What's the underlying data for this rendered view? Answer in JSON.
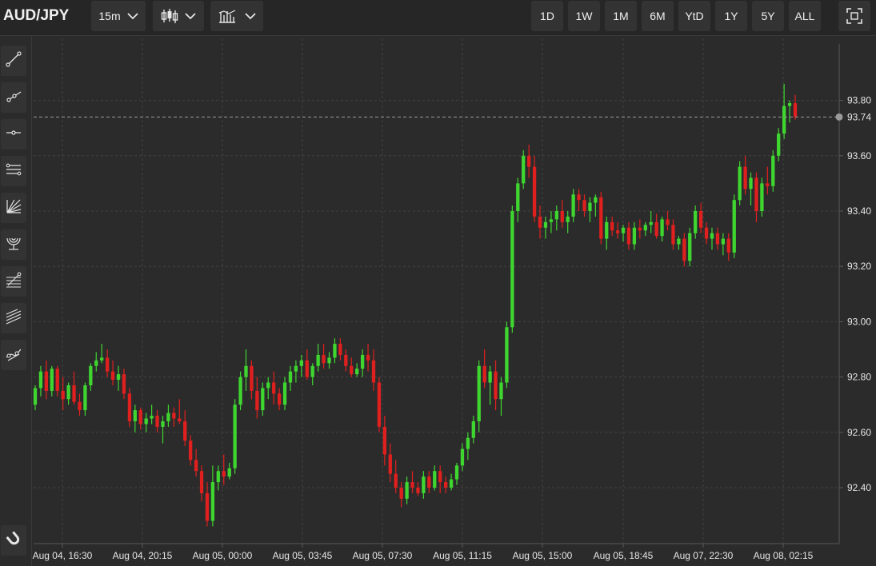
{
  "header": {
    "symbol": "AUD/JPY",
    "interval": "15m",
    "ranges": [
      "1D",
      "1W",
      "1M",
      "6M",
      "YtD",
      "1Y",
      "5Y",
      "ALL"
    ],
    "icons": {
      "interval_dropdown": "chevron-down-icon",
      "chart_type": "candlestick-icon",
      "indicators": "indicators-icon",
      "fullscreen": "fullscreen-icon"
    }
  },
  "sidebar": {
    "tools": [
      "trend-line-icon",
      "ray-icon",
      "horizontal-line-icon",
      "parallel-channel-icon",
      "fan-icon",
      "arc-icon",
      "fib-retracement-icon",
      "pitchfork-icon",
      "path-icon",
      "magnet-icon"
    ]
  },
  "chart_data": {
    "type": "candlestick",
    "title": "",
    "xlabel": "",
    "ylabel": "",
    "ylim": [
      92.18,
      94.0
    ],
    "grid": true,
    "last_price": 93.74,
    "y_ticks": [
      "92.40",
      "92.60",
      "92.80",
      "93.00",
      "93.20",
      "93.40",
      "93.60",
      "93.80"
    ],
    "y_tick_values": [
      92.4,
      92.6,
      92.8,
      93.0,
      93.2,
      93.4,
      93.6,
      93.8
    ],
    "last_price_label": "93.74",
    "x_ticks": [
      "Aug 04, 16:30",
      "Aug 04, 20:15",
      "Aug 05, 00:00",
      "Aug 05, 03:45",
      "Aug 05, 07:30",
      "Aug 05, 11:15",
      "Aug 05, 15:00",
      "Aug 05, 18:45",
      "Aug 07, 22:30",
      "Aug 08, 02:15"
    ],
    "colors": {
      "up": "#3fd630",
      "down": "#e0201e",
      "last_price_line": "#9a9a9a"
    },
    "candles": [
      [
        92.7,
        92.77,
        92.68,
        92.76
      ],
      [
        92.76,
        92.84,
        92.73,
        92.82
      ],
      [
        92.82,
        92.86,
        92.72,
        92.75
      ],
      [
        92.75,
        92.84,
        92.73,
        92.83
      ],
      [
        92.83,
        92.84,
        92.73,
        92.75
      ],
      [
        92.75,
        92.8,
        92.68,
        92.72
      ],
      [
        92.72,
        92.78,
        92.7,
        92.77
      ],
      [
        92.77,
        92.82,
        92.7,
        92.71
      ],
      [
        92.71,
        92.74,
        92.66,
        92.68
      ],
      [
        92.68,
        92.78,
        92.66,
        92.77
      ],
      [
        92.77,
        92.85,
        92.75,
        92.84
      ],
      [
        92.84,
        92.89,
        92.82,
        92.86
      ],
      [
        92.86,
        92.92,
        92.85,
        92.87
      ],
      [
        92.87,
        92.9,
        92.8,
        92.82
      ],
      [
        92.82,
        92.86,
        92.77,
        92.79
      ],
      [
        92.79,
        92.84,
        92.75,
        92.81
      ],
      [
        92.81,
        92.83,
        92.72,
        92.74
      ],
      [
        92.74,
        92.76,
        92.62,
        92.64
      ],
      [
        92.64,
        92.7,
        92.6,
        92.68
      ],
      [
        92.68,
        92.69,
        92.61,
        92.63
      ],
      [
        92.63,
        92.67,
        92.6,
        92.65
      ],
      [
        92.65,
        92.7,
        92.63,
        92.66
      ],
      [
        92.66,
        92.68,
        92.6,
        92.62
      ],
      [
        92.62,
        92.66,
        92.56,
        92.64
      ],
      [
        92.64,
        92.7,
        92.62,
        92.67
      ],
      [
        92.67,
        92.69,
        92.62,
        92.65
      ],
      [
        92.65,
        92.72,
        92.63,
        92.64
      ],
      [
        92.64,
        92.68,
        92.55,
        92.57
      ],
      [
        92.57,
        92.59,
        92.48,
        92.5
      ],
      [
        92.5,
        92.54,
        92.44,
        92.46
      ],
      [
        92.46,
        92.48,
        92.35,
        92.38
      ],
      [
        92.38,
        92.42,
        92.26,
        92.28
      ],
      [
        92.28,
        92.48,
        92.26,
        92.42
      ],
      [
        92.42,
        92.48,
        92.39,
        92.46
      ],
      [
        92.46,
        92.52,
        92.41,
        92.44
      ],
      [
        92.44,
        92.49,
        92.43,
        92.47
      ],
      [
        92.47,
        92.72,
        92.45,
        92.7
      ],
      [
        92.7,
        92.82,
        92.68,
        92.8
      ],
      [
        92.8,
        92.9,
        92.75,
        92.84
      ],
      [
        92.84,
        92.86,
        92.72,
        92.75
      ],
      [
        92.75,
        92.8,
        92.65,
        92.68
      ],
      [
        92.68,
        92.78,
        92.66,
        92.76
      ],
      [
        92.76,
        92.8,
        92.72,
        92.78
      ],
      [
        92.78,
        92.82,
        92.7,
        92.74
      ],
      [
        92.74,
        92.76,
        92.68,
        92.7
      ],
      [
        92.7,
        92.8,
        92.68,
        92.78
      ],
      [
        92.78,
        92.84,
        92.75,
        92.82
      ],
      [
        92.82,
        92.86,
        92.78,
        92.84
      ],
      [
        92.84,
        92.88,
        92.8,
        92.86
      ],
      [
        92.86,
        92.9,
        92.79,
        92.8
      ],
      [
        92.8,
        92.85,
        92.77,
        92.84
      ],
      [
        92.84,
        92.92,
        92.82,
        92.88
      ],
      [
        92.88,
        92.92,
        92.83,
        92.85
      ],
      [
        92.85,
        92.89,
        92.83,
        92.87
      ],
      [
        92.87,
        92.94,
        92.85,
        92.92
      ],
      [
        92.92,
        92.94,
        92.86,
        92.88
      ],
      [
        92.88,
        92.9,
        92.82,
        92.84
      ],
      [
        92.84,
        92.87,
        92.8,
        92.81
      ],
      [
        92.81,
        92.85,
        92.8,
        92.83
      ],
      [
        92.83,
        92.9,
        92.8,
        92.88
      ],
      [
        92.88,
        92.92,
        92.82,
        92.86
      ],
      [
        92.86,
        92.9,
        92.75,
        92.78
      ],
      [
        92.78,
        92.8,
        92.6,
        92.62
      ],
      [
        92.62,
        92.66,
        92.48,
        92.52
      ],
      [
        92.52,
        92.56,
        92.42,
        92.45
      ],
      [
        92.45,
        92.5,
        92.38,
        92.4
      ],
      [
        92.4,
        92.42,
        92.33,
        92.36
      ],
      [
        92.36,
        92.44,
        92.34,
        92.42
      ],
      [
        92.42,
        92.46,
        92.38,
        92.4
      ],
      [
        92.4,
        92.42,
        92.37,
        92.38
      ],
      [
        92.38,
        92.46,
        92.36,
        92.44
      ],
      [
        92.44,
        92.46,
        92.38,
        92.4
      ],
      [
        92.4,
        92.48,
        92.39,
        92.46
      ],
      [
        92.46,
        92.48,
        92.38,
        92.42
      ],
      [
        92.42,
        92.44,
        92.38,
        92.4
      ],
      [
        92.4,
        92.45,
        92.39,
        92.43
      ],
      [
        92.43,
        92.49,
        92.41,
        92.48
      ],
      [
        92.48,
        92.56,
        92.46,
        92.54
      ],
      [
        92.54,
        92.6,
        92.5,
        92.58
      ],
      [
        92.58,
        92.66,
        92.56,
        92.64
      ],
      [
        92.64,
        92.86,
        92.6,
        92.84
      ],
      [
        92.84,
        92.9,
        92.76,
        92.78
      ],
      [
        92.78,
        92.84,
        92.7,
        92.82
      ],
      [
        92.82,
        92.86,
        92.68,
        92.72
      ],
      [
        92.72,
        92.8,
        92.66,
        92.78
      ],
      [
        92.78,
        93.0,
        92.76,
        92.98
      ],
      [
        92.98,
        93.42,
        92.96,
        93.4
      ],
      [
        93.4,
        93.52,
        93.36,
        93.5
      ],
      [
        93.5,
        93.62,
        93.48,
        93.6
      ],
      [
        93.6,
        93.64,
        93.52,
        93.56
      ],
      [
        93.56,
        93.6,
        93.36,
        93.38
      ],
      [
        93.38,
        93.42,
        93.3,
        93.34
      ],
      [
        93.34,
        93.38,
        93.3,
        93.36
      ],
      [
        93.36,
        93.4,
        93.32,
        93.37
      ],
      [
        93.37,
        93.42,
        93.33,
        93.4
      ],
      [
        93.4,
        93.44,
        93.34,
        93.36
      ],
      [
        93.36,
        93.4,
        93.32,
        93.38
      ],
      [
        93.38,
        93.48,
        93.36,
        93.46
      ],
      [
        93.46,
        93.48,
        93.4,
        93.44
      ],
      [
        93.44,
        93.46,
        93.38,
        93.4
      ],
      [
        93.4,
        93.45,
        93.36,
        93.43
      ],
      [
        93.43,
        93.46,
        93.38,
        93.45
      ],
      [
        93.45,
        93.47,
        93.28,
        93.3
      ],
      [
        93.3,
        93.38,
        93.26,
        93.36
      ],
      [
        93.36,
        93.38,
        93.31,
        93.33
      ],
      [
        93.33,
        93.36,
        93.3,
        93.32
      ],
      [
        93.32,
        93.35,
        93.29,
        93.34
      ],
      [
        93.34,
        93.36,
        93.26,
        93.28
      ],
      [
        93.28,
        93.36,
        93.26,
        93.34
      ],
      [
        93.34,
        93.37,
        93.3,
        93.33
      ],
      [
        93.33,
        93.36,
        93.31,
        93.35
      ],
      [
        93.35,
        93.4,
        93.32,
        93.36
      ],
      [
        93.36,
        93.39,
        93.3,
        93.31
      ],
      [
        93.31,
        93.38,
        93.29,
        93.37
      ],
      [
        93.37,
        93.4,
        93.33,
        93.35
      ],
      [
        93.35,
        93.37,
        93.26,
        93.28
      ],
      [
        93.28,
        93.31,
        93.26,
        93.3
      ],
      [
        93.3,
        93.32,
        93.2,
        93.22
      ],
      [
        93.22,
        93.34,
        93.2,
        93.32
      ],
      [
        93.32,
        93.42,
        93.3,
        93.4
      ],
      [
        93.4,
        93.43,
        93.32,
        93.34
      ],
      [
        93.34,
        93.36,
        93.28,
        93.3
      ],
      [
        93.3,
        93.34,
        93.26,
        93.32
      ],
      [
        93.32,
        93.34,
        93.26,
        93.28
      ],
      [
        93.28,
        93.32,
        93.24,
        93.3
      ],
      [
        93.3,
        93.32,
        93.22,
        93.25
      ],
      [
        93.25,
        93.46,
        93.23,
        93.44
      ],
      [
        93.44,
        93.58,
        93.42,
        93.56
      ],
      [
        93.56,
        93.6,
        93.46,
        93.48
      ],
      [
        93.48,
        93.54,
        93.42,
        93.52
      ],
      [
        93.52,
        93.54,
        93.36,
        93.4
      ],
      [
        93.4,
        93.52,
        93.38,
        93.5
      ],
      [
        93.5,
        93.56,
        93.46,
        93.49
      ],
      [
        93.49,
        93.62,
        93.47,
        93.6
      ],
      [
        93.6,
        93.7,
        93.58,
        93.68
      ],
      [
        93.68,
        93.86,
        93.66,
        93.78
      ],
      [
        93.78,
        93.8,
        93.72,
        93.79
      ],
      [
        93.79,
        93.82,
        93.73,
        93.74
      ]
    ]
  }
}
